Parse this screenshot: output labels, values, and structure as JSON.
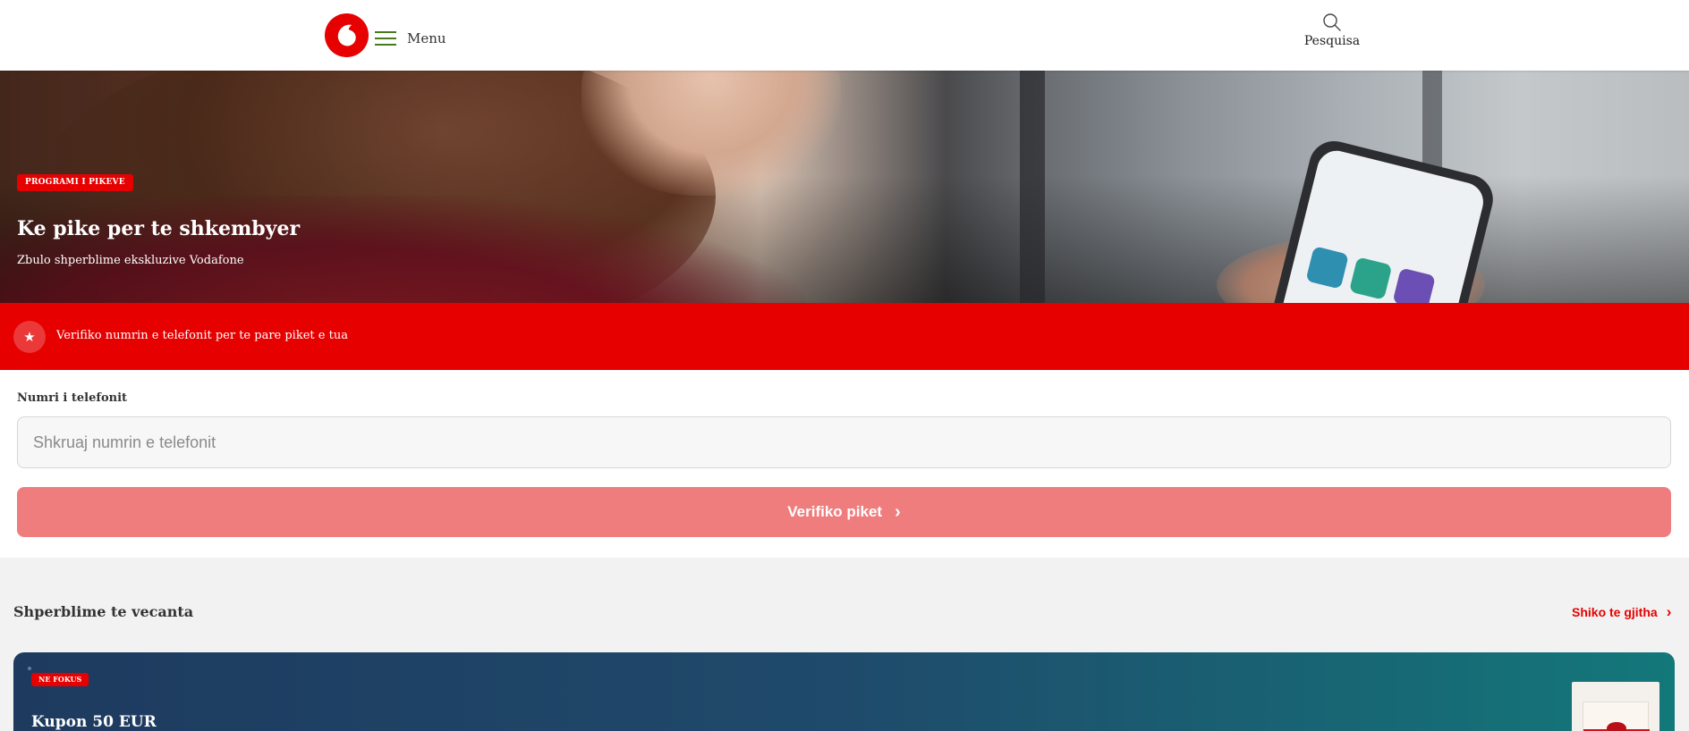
{
  "header": {
    "menu_label": "Menu",
    "search_label": "Pesquisa",
    "logo_icon": "vodafone-logo",
    "brand_color": "#e60000"
  },
  "hero": {
    "badge": "PROGRAMI I PIKEVE",
    "title": "Ke pike per te shkembyer",
    "subtitle": "Zbulo shperblime ekskluzive Vodafone"
  },
  "banner": {
    "icon": "star-icon",
    "text": "Verifiko numrin e telefonit per te pare piket e tua"
  },
  "form": {
    "label": "Numri i telefonit",
    "placeholder": "Shkruaj numrin e telefonit",
    "value": "",
    "button_label": "Verifiko piket",
    "button_color": "#f07d7d"
  },
  "rewards": {
    "section_title": "Shperblime te vecanta",
    "see_all": "Shiko te gjitha",
    "card": {
      "badge": "NE FOKUS",
      "title": "Kupon 50 EUR"
    }
  }
}
